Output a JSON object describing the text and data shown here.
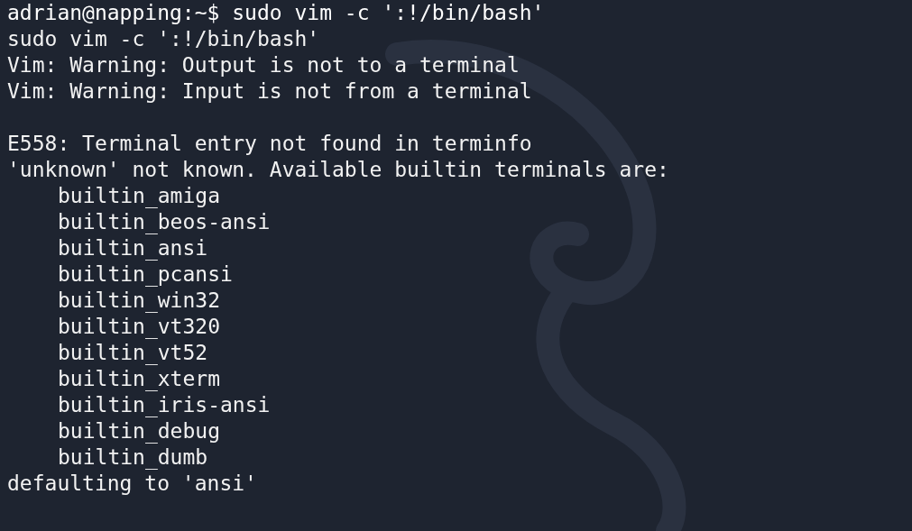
{
  "terminal": {
    "lines": [
      {
        "kind": "prompt",
        "text": "adrian@napping:~$ sudo vim -c ':!/bin/bash'"
      },
      {
        "kind": "output",
        "text": "sudo vim -c ':!/bin/bash'"
      },
      {
        "kind": "output",
        "text": "Vim: Warning: Output is not to a terminal"
      },
      {
        "kind": "output",
        "text": "Vim: Warning: Input is not from a terminal"
      },
      {
        "kind": "blank"
      },
      {
        "kind": "output",
        "text": "E558: Terminal entry not found in terminfo"
      },
      {
        "kind": "output",
        "text": "'unknown' not known. Available builtin terminals are:"
      },
      {
        "kind": "indented",
        "text": "builtin_amiga"
      },
      {
        "kind": "indented",
        "text": "builtin_beos-ansi"
      },
      {
        "kind": "indented",
        "text": "builtin_ansi"
      },
      {
        "kind": "indented",
        "text": "builtin_pcansi"
      },
      {
        "kind": "indented",
        "text": "builtin_win32"
      },
      {
        "kind": "indented",
        "text": "builtin_vt320"
      },
      {
        "kind": "indented",
        "text": "builtin_vt52"
      },
      {
        "kind": "indented",
        "text": "builtin_xterm"
      },
      {
        "kind": "indented",
        "text": "builtin_iris-ansi"
      },
      {
        "kind": "indented",
        "text": "builtin_debug"
      },
      {
        "kind": "indented",
        "text": "builtin_dumb"
      },
      {
        "kind": "output",
        "text": "defaulting to 'ansi'"
      }
    ]
  }
}
